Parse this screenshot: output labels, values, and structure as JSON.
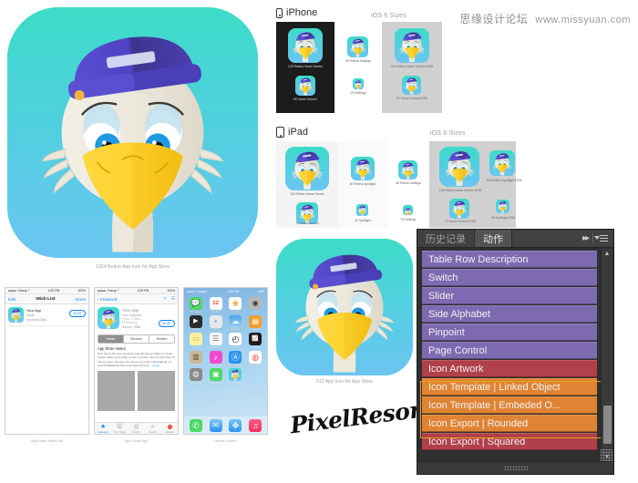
{
  "watermark": {
    "cn": "思缘设计论坛",
    "url": "www.missyuan.com"
  },
  "artwork": {
    "big_icon_caption": "1024 Retina App Icon for App Store",
    "mid_icon_caption": "512 App Icon for App Store",
    "brand": "PixelResort"
  },
  "iphone_section": {
    "label": "iPhone",
    "ios6_label": "iOS 6 Sizes",
    "tiles": [
      {
        "caption": "120 Retina Home Screen"
      },
      {
        "caption": "60 Home Screen"
      },
      {
        "caption": "58 Retina Settings"
      },
      {
        "caption": "29 Settings"
      },
      {
        "caption": "114 Retina Home Screen iOS6"
      },
      {
        "caption": "57 Home Screen iOS6"
      }
    ]
  },
  "ipad_section": {
    "label": "iPad",
    "ios6_label": "iOS 6 Sizes",
    "tiles": [
      {
        "caption": "152 Retina Home Screen"
      },
      {
        "caption": "76 Home Screen"
      },
      {
        "caption": "80 Retina Spotlight"
      },
      {
        "caption": "40 Spotlight"
      },
      {
        "caption": "58 Retina Settings"
      },
      {
        "caption": "29 Settings"
      },
      {
        "caption": "144 Retina Home Screen iOS6"
      },
      {
        "caption": "72 Home Screen iOS6"
      },
      {
        "caption": "100 Retina Spotlight iOS6"
      },
      {
        "caption": "50 Spotlight iOS6"
      }
    ]
  },
  "mockups": {
    "wishlist": {
      "caption": "App Store Wish List",
      "status": {
        "carrier": "●●●●○ Fanup ᛘ",
        "time": "4:20 PM",
        "battery": "100%"
      },
      "nav": {
        "left": "Edit",
        "title": "Wish List",
        "right": "Done"
      },
      "item": {
        "title": "Your App",
        "subtitle": "Health",
        "rating": "★★★★★ (1,234)",
        "price": "$1.99"
      }
    },
    "appstore": {
      "caption": "App Store App",
      "status": {
        "carrier": "●●●●○ Fanup ᛘ",
        "time": "4:20 PM",
        "battery": "100%"
      },
      "nav": {
        "back": "Featured"
      },
      "app_title": "Your App",
      "app_company": "Your Company ›",
      "app_category": "Photo & Video, Productivity",
      "app_rating": "★★★★☆ (578)",
      "app_price": "$1.99",
      "segments": [
        "Details",
        "Reviews",
        "Related"
      ],
      "notes_heading": "App Store Notes",
      "notes_body": "Now this is the story all about how My life got flipped, turned upside down And I'd like to take a minute Just sit right there I'll tell you how I became the prince of a town called Bel-air. In west Philadelphia born and raised On the",
      "notes_more": "…more",
      "tabs": [
        "Featured",
        "Top Charts",
        "Nearby",
        "Search",
        "Updates"
      ],
      "tab_badge": "2"
    },
    "homescreen": {
      "caption": "Home Screen",
      "status": {
        "carrier": "●●●●○ Fanup ᛘ",
        "time": "4:20 PM",
        "battery": "42%"
      },
      "apps": [
        {
          "label": "Messages",
          "color": "#4cd964",
          "glyph": "💬"
        },
        {
          "label": "Calendar",
          "color": "#ffffff",
          "glyph": "12"
        },
        {
          "label": "Photos",
          "color": "#ffffff",
          "glyph": "❀"
        },
        {
          "label": "Camera",
          "color": "#b3b3b3",
          "glyph": "◉"
        },
        {
          "label": "Videos",
          "color": "#2b2b2b",
          "glyph": "▶"
        },
        {
          "label": "Maps",
          "color": "#e8e8e8",
          "glyph": "⌖"
        },
        {
          "label": "Weather",
          "color": "#4aa8e8",
          "glyph": "☁"
        },
        {
          "label": "Passbook",
          "color": "#f0a030",
          "glyph": "▤"
        },
        {
          "label": "Notes",
          "color": "#fbf0a0",
          "glyph": "▭"
        },
        {
          "label": "Reminders",
          "color": "#f5f5f5",
          "glyph": "☰"
        },
        {
          "label": "Clock",
          "color": "#1c1c1c",
          "glyph": "◴"
        },
        {
          "label": "Stocks",
          "color": "#1c1c1c",
          "glyph": "📈"
        },
        {
          "label": "Newsstand",
          "color": "#c9b89a",
          "glyph": "▥"
        },
        {
          "label": "iTunes Store",
          "color": "#f04bd0",
          "glyph": "♪"
        },
        {
          "label": "App Store",
          "color": "#2a93f0",
          "glyph": "Ⓐ"
        },
        {
          "label": "Game Center",
          "color": "#ffffff",
          "glyph": "◍"
        },
        {
          "label": "Settings",
          "color": "#8a8a8a",
          "glyph": "⚙"
        },
        {
          "label": "FaceTime",
          "color": "#4cd964",
          "glyph": "▣"
        },
        {
          "label": "Your app",
          "color": "#3ddcc8",
          "glyph": "duck"
        }
      ],
      "page_dots": "•••",
      "dock": [
        {
          "label": "Phone",
          "color": "#4cd964",
          "glyph": "✆"
        },
        {
          "label": "Mail",
          "color": "#2a93f0",
          "glyph": "✉"
        },
        {
          "label": "Safari",
          "color": "#2a93f0",
          "glyph": "✥"
        },
        {
          "label": "Music",
          "color": "#fb2d5f",
          "glyph": "♫"
        }
      ]
    }
  },
  "photoshop_panel": {
    "tabs": [
      {
        "label": "历史记录",
        "active": false
      },
      {
        "label": "动作",
        "active": true
      }
    ],
    "collapse_icon": "double-chevron-right",
    "menu_icon": "panel-menu",
    "actions": [
      {
        "label": "Table Row Description",
        "color": "purple"
      },
      {
        "label": "Switch",
        "color": "purple"
      },
      {
        "label": "Slider",
        "color": "purple"
      },
      {
        "label": "Side Alphabet",
        "color": "purple"
      },
      {
        "label": "Pinpoint",
        "color": "purple"
      },
      {
        "label": "Page Control",
        "color": "purple"
      },
      {
        "label": "Icon Artwork",
        "color": "red"
      },
      {
        "label": "Icon Template | Linked Object",
        "color": "orange"
      },
      {
        "label": "Icon Template | Embeded O...",
        "color": "orange"
      },
      {
        "label": "Icon Export | Rounded",
        "color": "orange"
      },
      {
        "label": "Icon Export | Squared",
        "color": "red"
      }
    ],
    "colors": {
      "purple": "#7d6ab0",
      "red": "#b04049",
      "orange": "#e08433",
      "selection": "#e8a317"
    }
  }
}
